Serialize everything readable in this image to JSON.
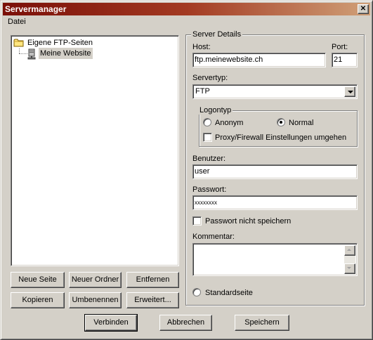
{
  "window": {
    "title": "Servermanager"
  },
  "menu": {
    "items": [
      {
        "label": "Datei"
      }
    ]
  },
  "tree": {
    "root": {
      "label": "Eigene FTP-Seiten"
    },
    "child": {
      "label": "Meine Website"
    }
  },
  "left_buttons": {
    "new_site": "Neue Seite",
    "new_folder": "Neuer Ordner",
    "remove": "Entfernen",
    "copy": "Kopieren",
    "rename": "Umbenennen",
    "advanced": "Erweitert..."
  },
  "details": {
    "legend": "Server Details",
    "host_label": "Host:",
    "host_value": "ftp.meinewebsite.ch",
    "port_label": "Port:",
    "port_value": "21",
    "servertype_label": "Servertyp:",
    "servertype_value": "FTP",
    "logontype_legend": "Logontyp",
    "radio_anonymous": "Anonym",
    "radio_normal": "Normal",
    "logontype_selected": "Normal",
    "proxy_checkbox": "Proxy/Firewall Einstellungen umgehen",
    "proxy_checked": false,
    "user_label": "Benutzer:",
    "user_value": "user",
    "password_label": "Passwort:",
    "password_value": "xxxxxxxx",
    "dont_save_password": "Passwort nicht speichern",
    "dont_save_password_checked": false,
    "comment_label": "Kommentar:",
    "comment_value": "",
    "default_site_label": "Standardseite",
    "default_site_selected": false
  },
  "bottom_buttons": {
    "connect": "Verbinden",
    "cancel": "Abbrechen",
    "save": "Speichern"
  },
  "colors": {
    "title_start": "#7a0f08",
    "title_end": "#d0a078",
    "face": "#d4d0c8"
  },
  "icons": {
    "close": "close-icon",
    "folder": "folder-icon",
    "server": "server-icon",
    "dropdown": "chevron-down-icon"
  }
}
